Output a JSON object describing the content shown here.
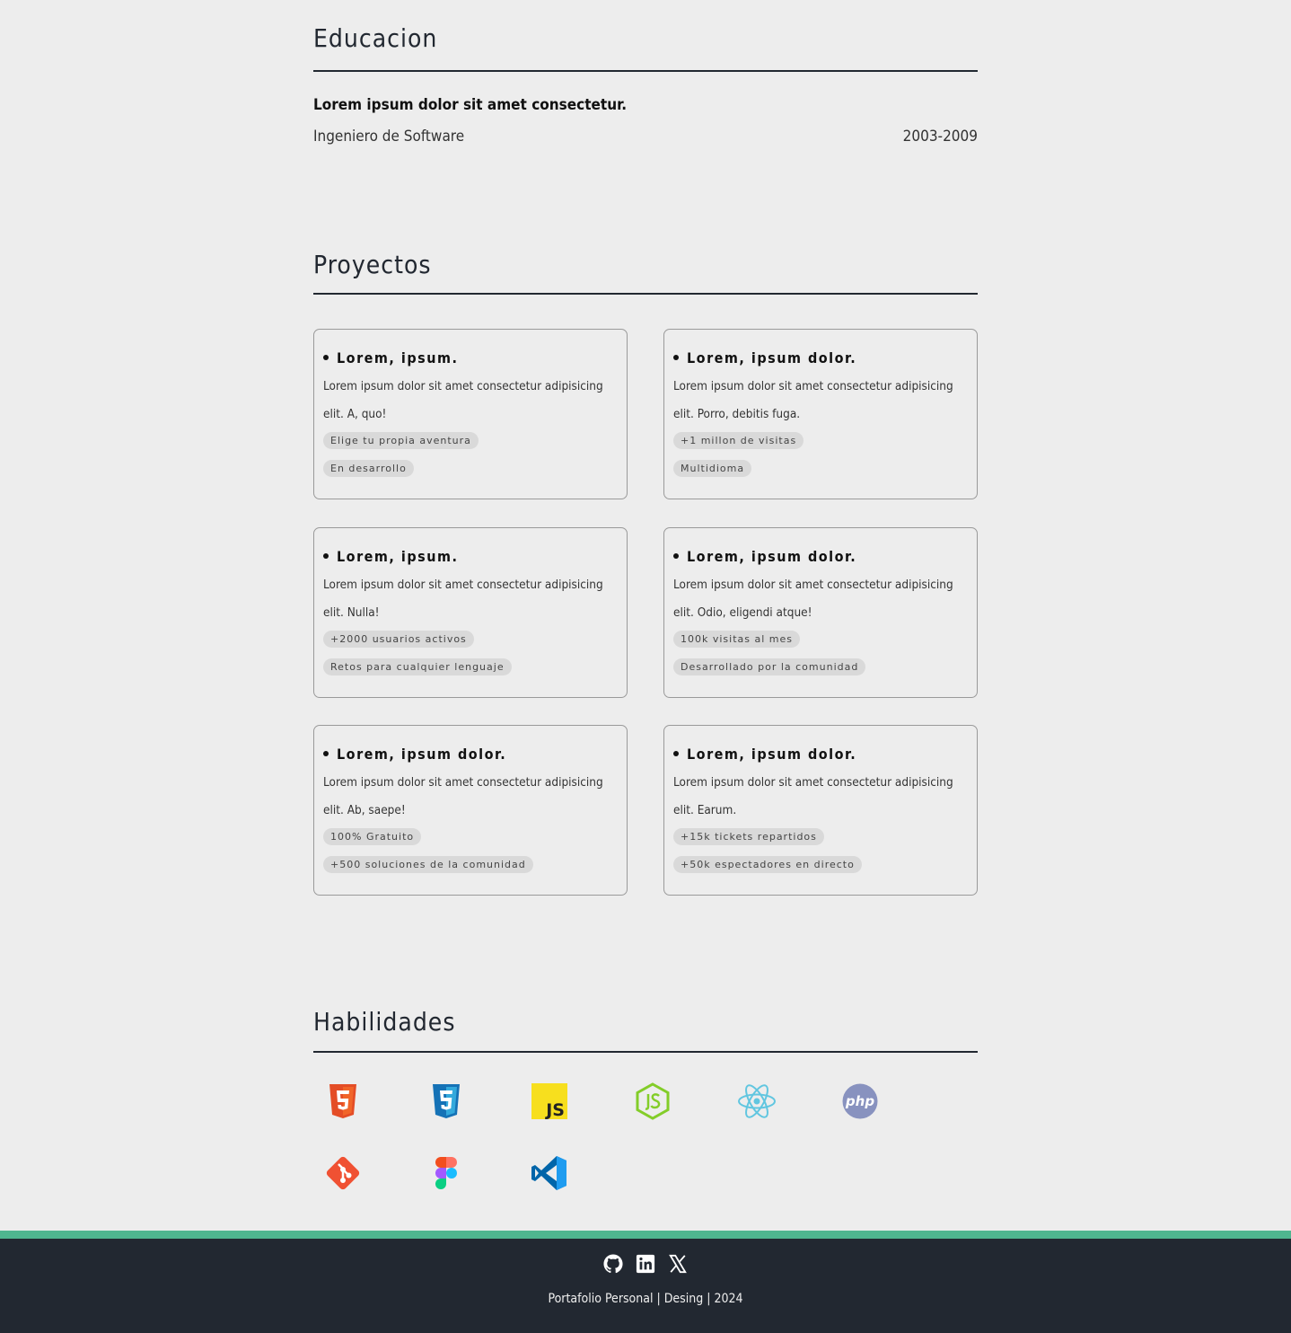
{
  "colors": {
    "background": "#ededed",
    "text": "#222831",
    "footer_bg": "#222831",
    "footer_accent": "#4fb58f"
  },
  "education": {
    "title": "Educacion",
    "heading": "Lorem ipsum dolor sit amet consectetur.",
    "degree": "Ingeniero de Software",
    "years": "2003-2009"
  },
  "projects": {
    "title": "Proyectos",
    "items": [
      {
        "title": "Lorem, ipsum.",
        "desc": "Lorem ipsum dolor sit amet consectetur adipisicing elit. A, quo!",
        "tags": [
          "Elige tu propia aventura",
          "En desarrollo"
        ]
      },
      {
        "title": "Lorem, ipsum dolor.",
        "desc": "Lorem ipsum dolor sit amet consectetur adipisicing elit. Porro, debitis fuga.",
        "tags": [
          "+1 millon de visitas",
          "Multidioma"
        ]
      },
      {
        "title": "Lorem, ipsum.",
        "desc": "Lorem ipsum dolor sit amet consectetur adipisicing elit. Nulla!",
        "tags": [
          "+2000 usuarios activos",
          "Retos para cualquier lenguaje"
        ]
      },
      {
        "title": "Lorem, ipsum dolor.",
        "desc": "Lorem ipsum dolor sit amet consectetur adipisicing elit. Odio, eligendi atque!",
        "tags": [
          "100k visitas al mes",
          "Desarrollado por la comunidad"
        ]
      },
      {
        "title": "Lorem, ipsum dolor.",
        "desc": "Lorem ipsum dolor sit amet consectetur adipisicing elit. Ab, saepe!",
        "tags": [
          "100% Gratuito",
          "+500 soluciones de la comunidad"
        ]
      },
      {
        "title": "Lorem, ipsum dolor.",
        "desc": "Lorem ipsum dolor sit amet consectetur adipisicing elit. Earum.",
        "tags": [
          "+15k tickets repartidos",
          "+50k espectadores en directo"
        ]
      }
    ]
  },
  "skills": {
    "title": "Habilidades",
    "icons": [
      "html5-icon",
      "css3-icon",
      "javascript-icon",
      "nodejs-icon",
      "react-icon",
      "php-icon",
      "git-icon",
      "figma-icon",
      "vscode-icon"
    ],
    "js_text": "JS",
    "php_text": "php"
  },
  "footer": {
    "social_icons": [
      "github-icon",
      "linkedin-icon",
      "x-icon"
    ],
    "text": "Portafolio Personal | Desing | 2024"
  }
}
